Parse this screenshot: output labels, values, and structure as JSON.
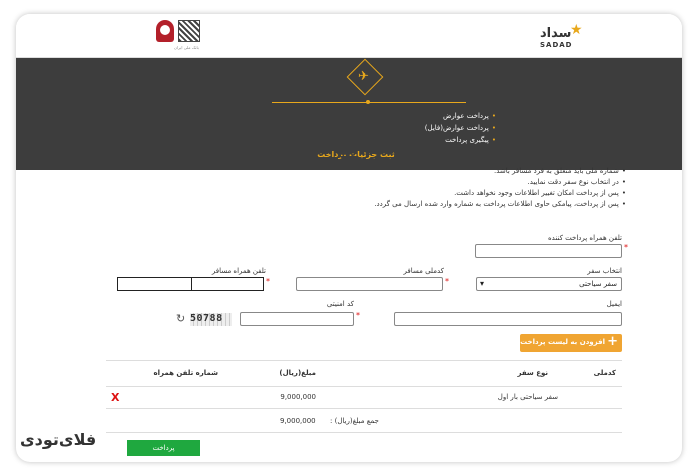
{
  "topbar": {
    "sadad_word": "سداد",
    "sadad_en": "SADAD",
    "bank_caption": "بانک ملی ایران"
  },
  "header": {
    "menu": [
      "پرداخت عوارض",
      "پرداخت عوارض(فایل)",
      "پیگیری پرداخت"
    ],
    "title": "ثبت جزئیات پرداخت"
  },
  "notes": [
    "شماره ملی باید متعلق به فرد مسافر باشد.",
    "در انتخاب نوع سفر دقت نمایید.",
    "پس از پرداخت امکان تغییر اطلاعات وجود نخواهد داشت.",
    "پس از پرداخت، پیامکی حاوی اطلاعات پرداخت به شماره وارد شده ارسال می گردد."
  ],
  "form": {
    "payer_phone_label": "تلفن همراه پرداخت کننده",
    "trip_select_label": "انتخاب سفر",
    "trip_select_value": "سفر سیاحتی",
    "traveler_id_label": "کدملی مسافر",
    "traveler_phone_label": "تلفن همراه مسافر",
    "email_label": "ایمیل",
    "security_code_label": "کد امنیتی",
    "captcha_text": "50788",
    "add_button": "افزودن به لیست پرداخت"
  },
  "table": {
    "headers": {
      "national_id": "کدملی",
      "trip_type": "نوع سفر",
      "amount": "مبلغ(ریال)",
      "phone": "شماره تلفن همراه"
    },
    "rows": [
      {
        "national_id": "",
        "trip_type": "سفر سیاحتی  بار اول",
        "amount": "9,000,000",
        "phone": ""
      }
    ],
    "total_label": "جمع مبلغ(ریال) :",
    "total_value": "9,000,000"
  },
  "pay_button": "پرداخت",
  "brand": "فلای‌تودی",
  "colors": {
    "accent": "#e8a81c",
    "header_bg": "#3d3d3d",
    "pay": "#1fa83f",
    "add": "#f0a532",
    "danger": "#dd1111"
  }
}
